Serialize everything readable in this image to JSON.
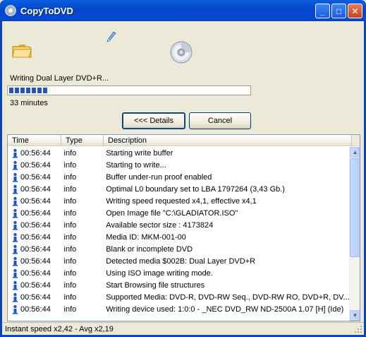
{
  "window": {
    "title": "CopyToDVD",
    "minimize_glyph": "_",
    "maximize_glyph": "□",
    "close_glyph": "✕"
  },
  "progress": {
    "status_text": "Writing Dual Layer DVD+R...",
    "fraction": 0.17,
    "time_remaining": "33 minutes"
  },
  "buttons": {
    "details_label": "<<< Details",
    "cancel_label": "Cancel"
  },
  "log": {
    "columns": [
      "Time",
      "Type",
      "Description"
    ],
    "rows": [
      {
        "time": "00:56:44",
        "type": "info",
        "desc": "Starting write buffer"
      },
      {
        "time": "00:56:44",
        "type": "info",
        "desc": "Starting to write..."
      },
      {
        "time": "00:56:44",
        "type": "info",
        "desc": "Buffer under-run proof enabled"
      },
      {
        "time": "00:56:44",
        "type": "info",
        "desc": "Optimal L0 boundary set to LBA 1797264 (3,43 Gb.)"
      },
      {
        "time": "00:56:44",
        "type": "info",
        "desc": "Writing speed requested x4,1, effective x4,1"
      },
      {
        "time": "00:56:44",
        "type": "info",
        "desc": "Open Image file \"C:\\GLADIATOR.ISO\""
      },
      {
        "time": "00:56:44",
        "type": "info",
        "desc": "Available sector size : 4173824"
      },
      {
        "time": "00:56:44",
        "type": "info",
        "desc": "Media ID: MKM-001-00"
      },
      {
        "time": "00:56:44",
        "type": "info",
        "desc": "Blank or incomplete DVD"
      },
      {
        "time": "00:56:44",
        "type": "info",
        "desc": "Detected media $002B: Dual Layer DVD+R"
      },
      {
        "time": "00:56:44",
        "type": "info",
        "desc": "Using ISO image writing mode."
      },
      {
        "time": "00:56:44",
        "type": "info",
        "desc": "Start Browsing file structures"
      },
      {
        "time": "00:56:44",
        "type": "info",
        "desc": "Supported Media: DVD-R, DVD-RW Seq., DVD-RW RO, DVD+R, DV..."
      },
      {
        "time": "00:56:44",
        "type": "info",
        "desc": "Writing device used: 1:0:0 - _NEC DVD_RW ND-2500A 1.07 [H] (Ide)"
      }
    ]
  },
  "statusbar": {
    "text": "Instant speed x2,42 - Avg x2,19"
  },
  "icons": {
    "title": "disc-icon",
    "folder": "folder-icon",
    "pen": "pen-icon",
    "disc": "dvd-disc-icon",
    "row": "info-icon"
  },
  "colors": {
    "titlebar": "#0347c8",
    "progress_fill": "#2a52c8",
    "background": "#ece9d8"
  }
}
